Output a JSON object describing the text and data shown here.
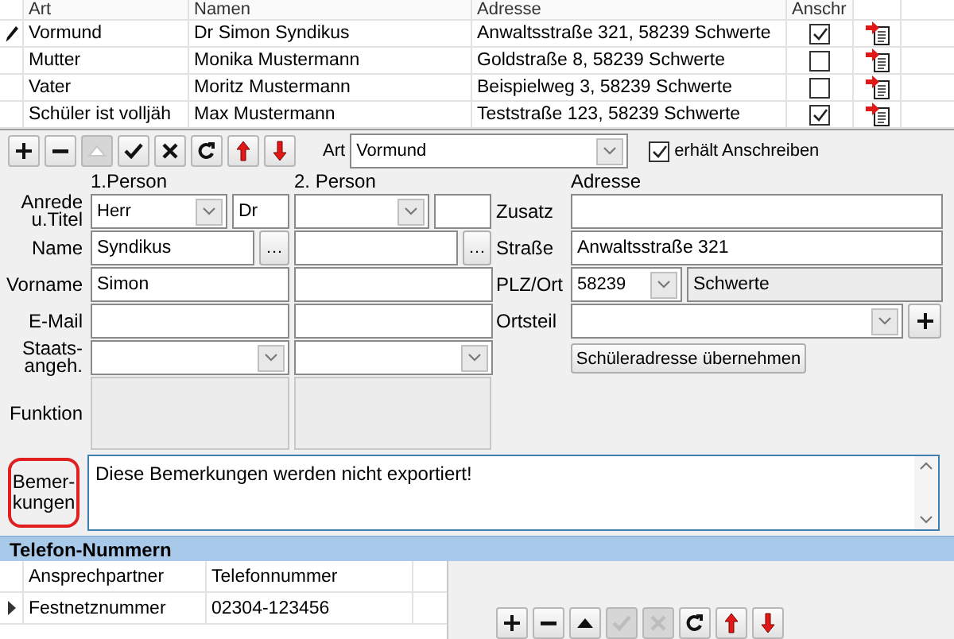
{
  "guardians_table": {
    "columns": [
      "Art",
      "Namen",
      "Adresse",
      "Anschr"
    ],
    "rows": [
      {
        "type": "Vormund",
        "name": "Dr Simon Syndikus",
        "address": "Anwaltsstraße 321, 58239 Schwerte",
        "letter": true,
        "selected": true
      },
      {
        "type": "Mutter",
        "name": "Monika Mustermann",
        "address": "Goldstraße 8, 58239 Schwerte",
        "letter": false,
        "selected": false
      },
      {
        "type": "Vater",
        "name": "Moritz Mustermann",
        "address": "Beispielweg 3, 58239 Schwerte",
        "letter": false,
        "selected": false
      },
      {
        "type": "Schüler ist volljäh",
        "name": "Max Mustermann",
        "address": "Teststraße 123, 58239 Schwerte",
        "letter": true,
        "selected": false
      }
    ]
  },
  "toolbar": [
    {
      "kind": "add",
      "disabled": false
    },
    {
      "kind": "remove",
      "disabled": false
    },
    {
      "kind": "up",
      "disabled": true
    },
    {
      "kind": "save",
      "disabled": false
    },
    {
      "kind": "cancel",
      "disabled": false
    },
    {
      "kind": "refresh",
      "disabled": false
    },
    {
      "kind": "move_up",
      "disabled": false
    },
    {
      "kind": "move_down",
      "disabled": false
    }
  ],
  "art_field": {
    "label": "Art",
    "value": "Vormund"
  },
  "receives_letter": {
    "label": "erhält Anschreiben",
    "checked": true
  },
  "form": {
    "person1_heading": "1.Person",
    "person2_heading": "2. Person",
    "address_heading": "Adresse",
    "labels": [
      "Anrede u.Titel",
      "Name",
      "Vorname",
      "E-Mail",
      "Staats- angeh.",
      "Funktion"
    ],
    "person1": {
      "salutation": "Herr",
      "title": "Dr",
      "last_name": "Syndikus",
      "first_name": "Simon"
    },
    "more_button": "…",
    "address_fields": [
      {
        "label": "Zusatz",
        "kind": "text"
      },
      {
        "label": "Straße",
        "kind": "text",
        "value": "Anwaltsstraße 321"
      },
      {
        "label": "PLZ/Ort",
        "kind": "zip_city",
        "zip": "58239",
        "city": "Schwerte"
      },
      {
        "label": "Ortsteil",
        "kind": "combo_add"
      }
    ],
    "copy_address_button": "Schüleradresse übernehmen"
  },
  "remarks": {
    "label": "Bemer- kungen",
    "value": "Diese Bemerkungen werden nicht exportiert!",
    "highlighted": true
  },
  "phones": {
    "title": "Telefon-Nummern",
    "columns": [
      "Ansprechpartner",
      "Telefonnummer"
    ],
    "rows": [
      {
        "contact": "Festnetznummer",
        "number": "02304-123456",
        "selected": true
      }
    ],
    "toolbar": [
      {
        "kind": "add",
        "disabled": false
      },
      {
        "kind": "remove",
        "disabled": false
      },
      {
        "kind": "up",
        "disabled": false
      },
      {
        "kind": "save",
        "disabled": true
      },
      {
        "kind": "cancel",
        "disabled": true
      },
      {
        "kind": "refresh",
        "disabled": false
      },
      {
        "kind": "move_up",
        "disabled": false
      },
      {
        "kind": "move_down",
        "disabled": false
      }
    ]
  }
}
